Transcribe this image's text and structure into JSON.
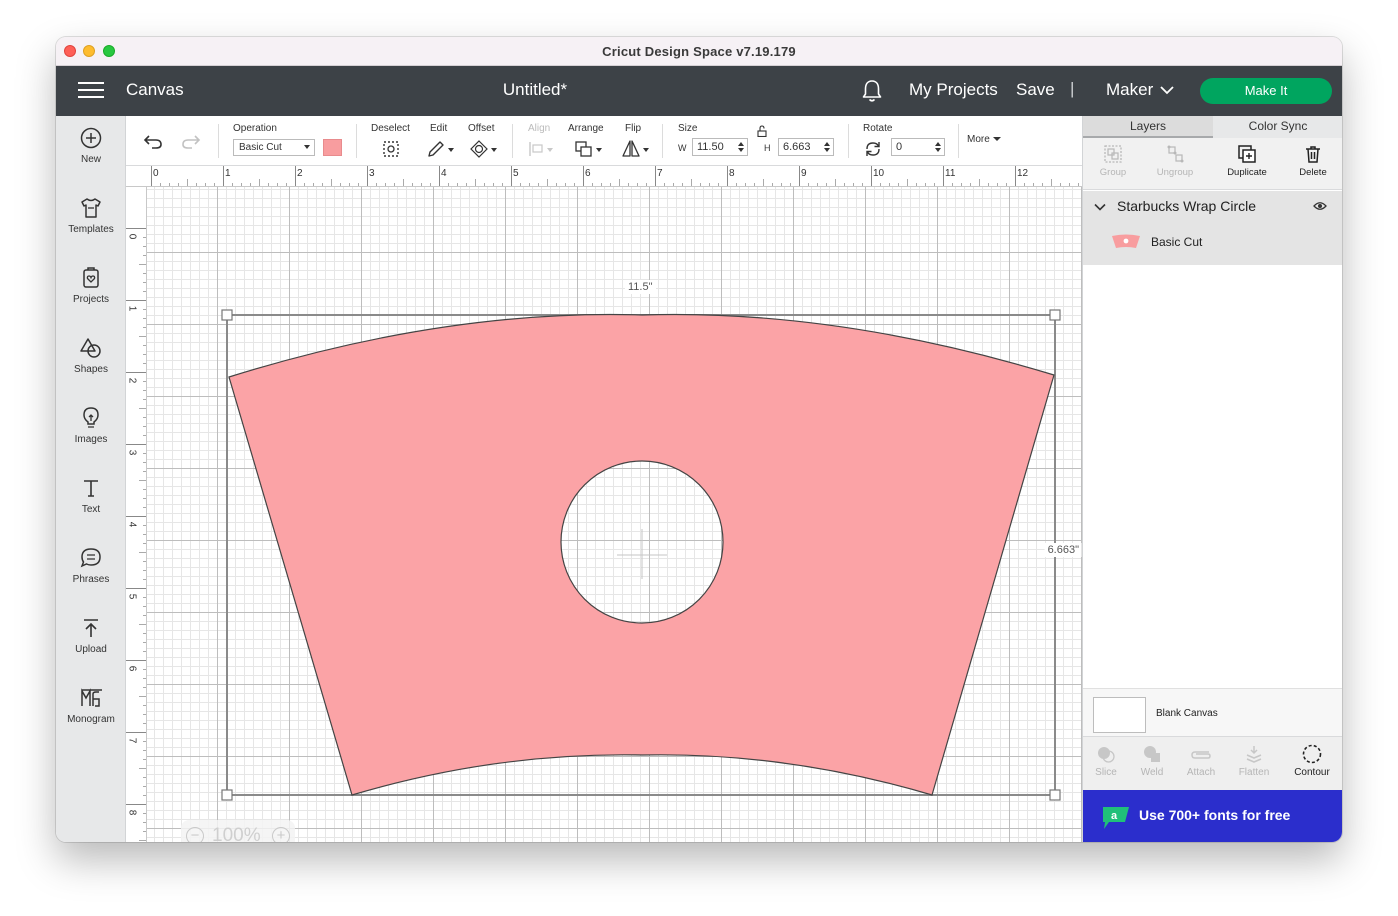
{
  "window": {
    "title": "Cricut Design Space  v7.19.179"
  },
  "appbar": {
    "section": "Canvas",
    "document_title": "Untitled*",
    "my_projects": "My Projects",
    "save": "Save",
    "separator": "|",
    "machine": "Maker",
    "make_it": "Make It"
  },
  "leftnav": {
    "items": [
      {
        "label": "New",
        "icon": "plus-circle-icon"
      },
      {
        "label": "Templates",
        "icon": "tshirt-icon"
      },
      {
        "label": "Projects",
        "icon": "projects-icon"
      },
      {
        "label": "Shapes",
        "icon": "shapes-icon"
      },
      {
        "label": "Images",
        "icon": "lightbulb-icon"
      },
      {
        "label": "Text",
        "icon": "text-icon"
      },
      {
        "label": "Phrases",
        "icon": "speech-bubble-icon"
      },
      {
        "label": "Upload",
        "icon": "upload-icon"
      },
      {
        "label": "Monogram",
        "icon": "monogram-icon"
      }
    ]
  },
  "toolbar": {
    "operation_label": "Operation",
    "operation_value": "Basic Cut",
    "operation_color": "#f89d9f",
    "deselect": "Deselect",
    "edit": "Edit",
    "offset": "Offset",
    "align": "Align",
    "arrange": "Arrange",
    "flip": "Flip",
    "size": "Size",
    "w_letter": "W",
    "width": "11.50",
    "h_letter": "H",
    "height": "6.663",
    "rotate": "Rotate",
    "rotation": "0",
    "more": "More"
  },
  "rulers": {
    "top": [
      "0",
      "1",
      "2",
      "3",
      "4",
      "5",
      "6",
      "7",
      "8",
      "9",
      "10",
      "11",
      "12"
    ],
    "left": [
      "0",
      "1",
      "2",
      "3",
      "4",
      "5",
      "6",
      "7",
      "8"
    ]
  },
  "canvas": {
    "width_label": "11.5\"",
    "height_label": "6.663\"",
    "shape_color": "#fba3a6",
    "zoom_out": "−",
    "zoom": "100%",
    "zoom_in": "+"
  },
  "right_panel": {
    "tabs": [
      "Layers",
      "Color Sync"
    ],
    "actions": [
      {
        "label": "Group",
        "enabled": false,
        "icon": "group-icon"
      },
      {
        "label": "Ungroup",
        "enabled": false,
        "icon": "ungroup-icon"
      },
      {
        "label": "Duplicate",
        "enabled": true,
        "icon": "duplicate-icon"
      },
      {
        "label": "Delete",
        "enabled": true,
        "icon": "trash-icon"
      }
    ],
    "layer_group": {
      "name": "Starbucks Wrap Circle",
      "layer": "Basic Cut"
    },
    "blank_canvas": "Blank Canvas",
    "bottom_actions": [
      {
        "label": "Slice",
        "enabled": false,
        "icon": "slice-icon"
      },
      {
        "label": "Weld",
        "enabled": false,
        "icon": "weld-icon"
      },
      {
        "label": "Attach",
        "enabled": false,
        "icon": "attach-icon"
      },
      {
        "label": "Flatten",
        "enabled": false,
        "icon": "flatten-icon"
      },
      {
        "label": "Contour",
        "enabled": true,
        "icon": "contour-icon"
      }
    ],
    "promo": "Use 700+ fonts for free"
  }
}
